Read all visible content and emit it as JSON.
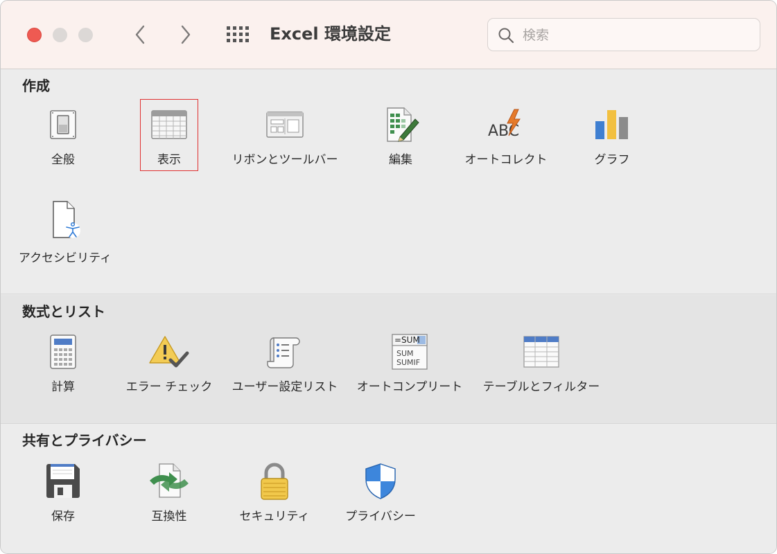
{
  "window": {
    "title": "Excel 環境設定",
    "search_placeholder": "検索"
  },
  "sections": [
    {
      "title": "作成",
      "items": [
        {
          "label": "全般",
          "icon": "general-switch-icon"
        },
        {
          "label": "表示",
          "icon": "view-table-icon",
          "highlighted": true
        },
        {
          "label": "リボンとツールバー",
          "icon": "ribbon-toolbar-icon"
        },
        {
          "label": "編集",
          "icon": "edit-sheet-pencil-icon"
        },
        {
          "label": "オートコレクト",
          "icon": "autocorrect-abc-icon"
        },
        {
          "label": "グラフ",
          "icon": "chart-bars-icon"
        },
        {
          "label": "アクセシビリティ",
          "icon": "accessibility-icon"
        }
      ]
    },
    {
      "title": "数式とリスト",
      "items": [
        {
          "label": "計算",
          "icon": "calculator-icon"
        },
        {
          "label": "エラー チェック",
          "icon": "error-check-warning-icon"
        },
        {
          "label": "ユーザー設定リスト",
          "icon": "custom-list-scroll-icon"
        },
        {
          "label": "オートコンプリート",
          "icon": "autocomplete-sum-icon"
        },
        {
          "label": "テーブルとフィルター",
          "icon": "table-filter-icon"
        }
      ]
    },
    {
      "title": "共有とプライバシー",
      "items": [
        {
          "label": "保存",
          "icon": "save-floppy-icon"
        },
        {
          "label": "互換性",
          "icon": "compatibility-icon"
        },
        {
          "label": "セキュリティ",
          "icon": "security-padlock-icon"
        },
        {
          "label": "プライバシー",
          "icon": "privacy-shield-icon"
        }
      ]
    }
  ],
  "autocomplete_icon_text": {
    "line1": "=SUM",
    "line2": "SUM",
    "line3": "SUMIF"
  },
  "autocorrect_icon_text": "ABC",
  "colors": {
    "titlebar": "#fbf1ee",
    "close": "#ee5a52",
    "highlight_border": "#e03030"
  }
}
